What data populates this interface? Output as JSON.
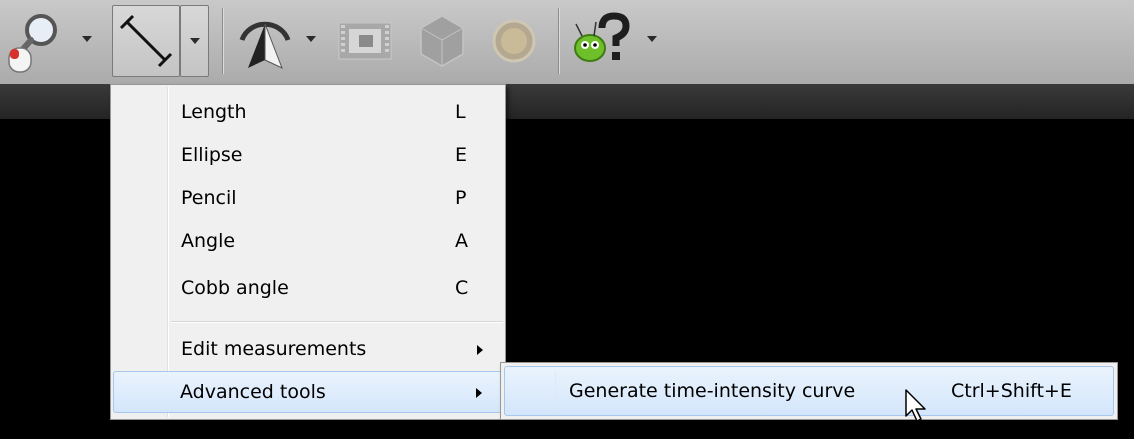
{
  "toolbar": {
    "buttons": [
      {
        "name": "zoom-tool",
        "icon": "magnifier-mouse-icon"
      },
      {
        "name": "measure-tool",
        "icon": "line-ruler-icon",
        "pressed": true
      },
      {
        "name": "orientation-tool",
        "icon": "3d-rotate-icon"
      },
      {
        "name": "movie-tool",
        "icon": "film-icon"
      },
      {
        "name": "mpr-tool",
        "icon": "mpr-cube-icon"
      },
      {
        "name": "fusion-tool",
        "icon": "fusion-icon"
      },
      {
        "name": "help-tool",
        "icon": "help-bug-icon"
      }
    ]
  },
  "menu": {
    "items": [
      {
        "label": "Length",
        "shortcut": "L"
      },
      {
        "label": "Ellipse",
        "shortcut": "E"
      },
      {
        "label": "Pencil",
        "shortcut": "P"
      },
      {
        "label": "Angle",
        "shortcut": "A"
      },
      {
        "label": "Cobb angle",
        "shortcut": "C"
      }
    ],
    "edit_measurements": "Edit measurements",
    "advanced_tools": "Advanced tools"
  },
  "submenu": {
    "item_label": "Generate time-intensity curve",
    "item_shortcut": "Ctrl+Shift+E"
  },
  "colors": {
    "toolbar_bg": "#b7b7b7",
    "menu_bg": "#f0f0f0",
    "highlight": "#d4e6fb",
    "viewport_bg": "#000000"
  }
}
